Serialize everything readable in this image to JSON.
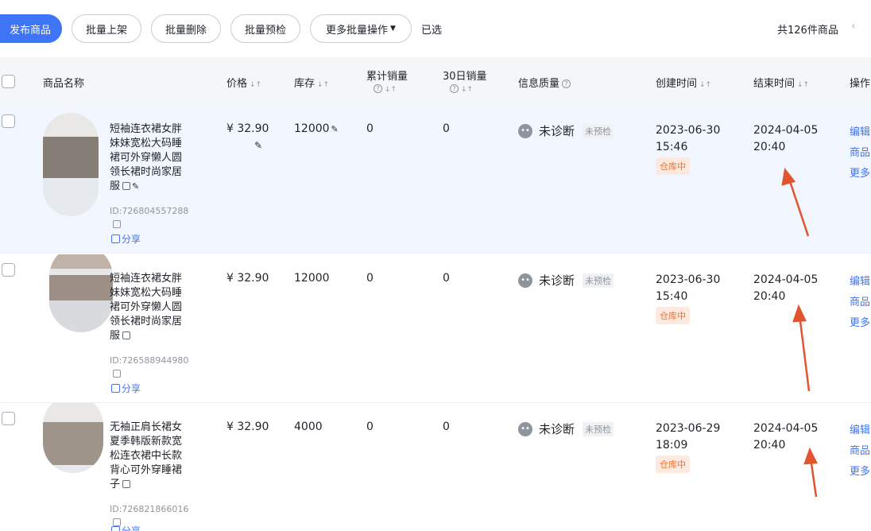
{
  "toolbar": {
    "publish": "发布商品",
    "batch_list": "批量上架",
    "batch_delete": "批量删除",
    "batch_precheck": "批量预检",
    "more_batch": "更多批量操作",
    "selected": "已选",
    "total": "共126件商品"
  },
  "table": {
    "headers": {
      "name": "商品名称",
      "price": "价格",
      "stock": "库存",
      "total_sales": "累计销量",
      "sales_30d": "30日销量",
      "info_quality": "信息质量",
      "created": "创建时间",
      "ended": "结束时间",
      "ops": "操作"
    },
    "rows": [
      {
        "name": "短袖连衣裙女胖妹妹宽松大码睡裙可外穿懒人圆领长裙时尚家居服",
        "id": "ID:726804557288",
        "share": "分享",
        "price": "¥ 32.90",
        "stock": "12000",
        "total_sales": "0",
        "sales_30d": "0",
        "diag": "未诊断",
        "precheck": "未预检",
        "created_date": "2023-06-30",
        "created_time": "15:46",
        "status": "仓库中",
        "end_date": "2024-04-05",
        "end_time": "20:40",
        "op1": "编辑",
        "op2": "商品",
        "op3": "更多"
      },
      {
        "name": "短袖连衣裙女胖妹妹宽松大码睡裙可外穿懒人圆领长裙时尚家居服",
        "id": "ID:726588944980",
        "share": "分享",
        "price": "¥ 32.90",
        "stock": "12000",
        "total_sales": "0",
        "sales_30d": "0",
        "diag": "未诊断",
        "precheck": "未预检",
        "created_date": "2023-06-30",
        "created_time": "15:40",
        "status": "仓库中",
        "end_date": "2024-04-05",
        "end_time": "20:40",
        "op1": "编辑",
        "op2": "商品",
        "op3": "更多"
      },
      {
        "name": "无袖正肩长裙女夏季韩版新款宽松连衣裙中长款背心可外穿睡裙子",
        "id": "ID:726821866016",
        "share": "分享",
        "price": "¥ 32.90",
        "stock": "4000",
        "total_sales": "0",
        "sales_30d": "0",
        "diag": "未诊断",
        "precheck": "未预检",
        "created_date": "2023-06-29",
        "created_time": "18:09",
        "status": "仓库中",
        "end_date": "2024-04-05",
        "end_time": "20:40",
        "op1": "编辑",
        "op2": "商品",
        "op3": "更多"
      }
    ]
  },
  "colors": {
    "primary": "#3e74f6",
    "header_bg": "#f5f6f7",
    "row_highlight": "#f2f6fe",
    "warehouse_badge": "#f0712e",
    "annotation_arrow": "#e0542e"
  },
  "icons": [
    "sort-icon",
    "help-icon",
    "pencil-icon",
    "copy-icon",
    "share-icon",
    "face-icon",
    "chevron-down-icon",
    "chevron-left-icon"
  ]
}
